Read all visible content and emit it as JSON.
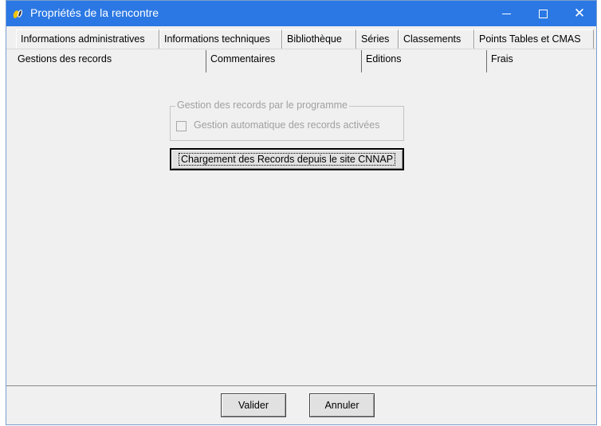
{
  "window": {
    "title": "Propriétés de la rencontre",
    "icon": "app-logo-icon",
    "controls": {
      "minimize": "—",
      "maximize": "☐",
      "close": "✕"
    },
    "accent_color": "#2b78e4"
  },
  "tabs_row1": [
    {
      "label": "Informations administratives"
    },
    {
      "label": "Informations techniques"
    },
    {
      "label": "Bibliothèque"
    },
    {
      "label": "Séries"
    },
    {
      "label": "Classements"
    },
    {
      "label": "Points Tables et CMAS"
    }
  ],
  "tabs_row2": [
    {
      "label": "Gestions des records",
      "selected": true
    },
    {
      "label": "Commentaires"
    },
    {
      "label": "Editions"
    },
    {
      "label": "Frais"
    }
  ],
  "records": {
    "group_label": "Gestion des records par le programme",
    "auto_checkbox_label": "Gestion automatique des records activées",
    "auto_checked": false,
    "auto_enabled": false,
    "load_button": "Chargement des Records depuis le site CNNAP"
  },
  "footer": {
    "ok_button": "Valider",
    "cancel_button": "Annuler"
  }
}
